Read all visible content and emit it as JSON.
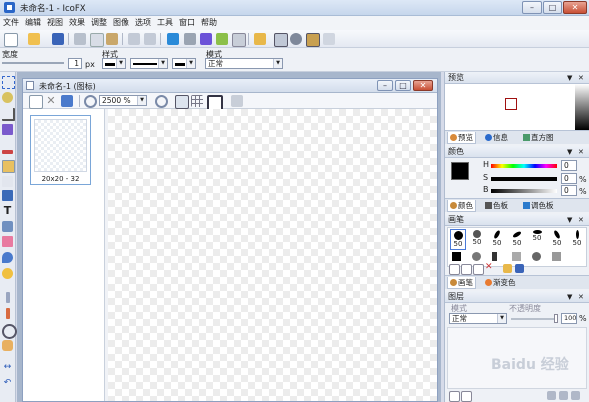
{
  "window": {
    "title": "未命名-1 - IcoFX",
    "min": "–",
    "max": "□",
    "close": "✕"
  },
  "menu": [
    "文件",
    "编辑",
    "视图",
    "效果",
    "调整",
    "图像",
    "选项",
    "工具",
    "窗口",
    "帮助"
  ],
  "toolbar2": {
    "width_label": "宽度",
    "width_value": "1",
    "width_unit": "px",
    "style_label": "样式",
    "mode_label": "模式",
    "mode_value": "正常"
  },
  "document": {
    "title": "未命名-1 (图标)",
    "zoom": "2500 %",
    "thumb_label": "20x20 - 32"
  },
  "preview_panel": {
    "title": "预览",
    "tabs": [
      "预览",
      "信息",
      "直方图"
    ]
  },
  "color_panel": {
    "title": "颜色",
    "h_label": "H",
    "s_label": "S",
    "b_label": "B",
    "h_value": "0",
    "s_value": "0",
    "b_value": "0",
    "unit": "%",
    "primary_color": "#000000",
    "secondary_color": "#ffffff",
    "tabs": [
      "颜色",
      "色板",
      "调色板"
    ]
  },
  "brush_panel": {
    "title": "画笔",
    "sizes": [
      "50",
      "50",
      "50",
      "50",
      "50",
      "50",
      "50"
    ],
    "tabs": [
      "画笔",
      "渐变色"
    ]
  },
  "layer_panel": {
    "title": "图层",
    "mode_label": "模式",
    "opacity_label": "不透明度",
    "mode_value": "正常",
    "opacity_value": "100",
    "opacity_unit": "%"
  },
  "watermark": "Baidu 经验"
}
